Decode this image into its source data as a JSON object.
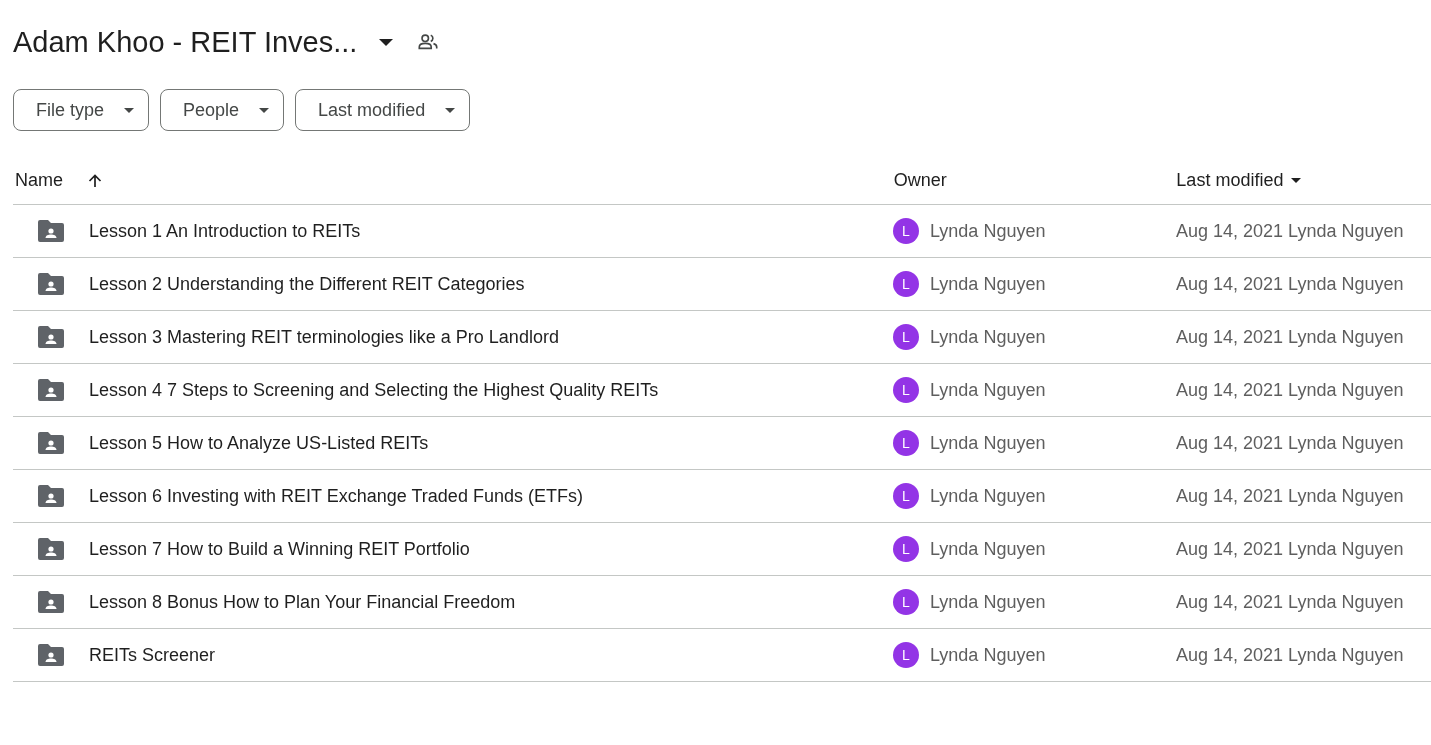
{
  "folder": {
    "title": "Adam Khoo - REIT Inves..."
  },
  "filters": [
    {
      "label": "File type"
    },
    {
      "label": "People"
    },
    {
      "label": "Last modified"
    }
  ],
  "table": {
    "columns": [
      {
        "label": "Name"
      },
      {
        "label": "Owner"
      },
      {
        "label": "Last modified"
      }
    ],
    "rows": [
      {
        "name": "Lesson 1 An Introduction to REITs",
        "owner_initial": "L",
        "owner": "Lynda Nguyen",
        "last_modified": "Aug 14, 2021 Lynda Nguyen"
      },
      {
        "name": "Lesson 2 Understanding the Different REIT Categories",
        "owner_initial": "L",
        "owner": "Lynda Nguyen",
        "last_modified": "Aug 14, 2021 Lynda Nguyen"
      },
      {
        "name": "Lesson 3 Mastering REIT terminologies like a Pro Landlord",
        "owner_initial": "L",
        "owner": "Lynda Nguyen",
        "last_modified": "Aug 14, 2021 Lynda Nguyen"
      },
      {
        "name": "Lesson 4 7 Steps to Screening and Selecting the Highest Quality REITs",
        "owner_initial": "L",
        "owner": "Lynda Nguyen",
        "last_modified": "Aug 14, 2021 Lynda Nguyen"
      },
      {
        "name": "Lesson 5 How to Analyze US-Listed REITs",
        "owner_initial": "L",
        "owner": "Lynda Nguyen",
        "last_modified": "Aug 14, 2021 Lynda Nguyen"
      },
      {
        "name": "Lesson 6 Investing with REIT Exchange Traded Funds (ETFs)",
        "owner_initial": "L",
        "owner": "Lynda Nguyen",
        "last_modified": "Aug 14, 2021 Lynda Nguyen"
      },
      {
        "name": "Lesson 7 How to Build a Winning REIT Portfolio",
        "owner_initial": "L",
        "owner": "Lynda Nguyen",
        "last_modified": "Aug 14, 2021 Lynda Nguyen"
      },
      {
        "name": "Lesson 8 Bonus How to Plan Your Financial Freedom",
        "owner_initial": "L",
        "owner": "Lynda Nguyen",
        "last_modified": "Aug 14, 2021 Lynda Nguyen"
      },
      {
        "name": "REITs Screener",
        "owner_initial": "L",
        "owner": "Lynda Nguyen",
        "last_modified": "Aug 14, 2021 Lynda Nguyen"
      }
    ]
  }
}
